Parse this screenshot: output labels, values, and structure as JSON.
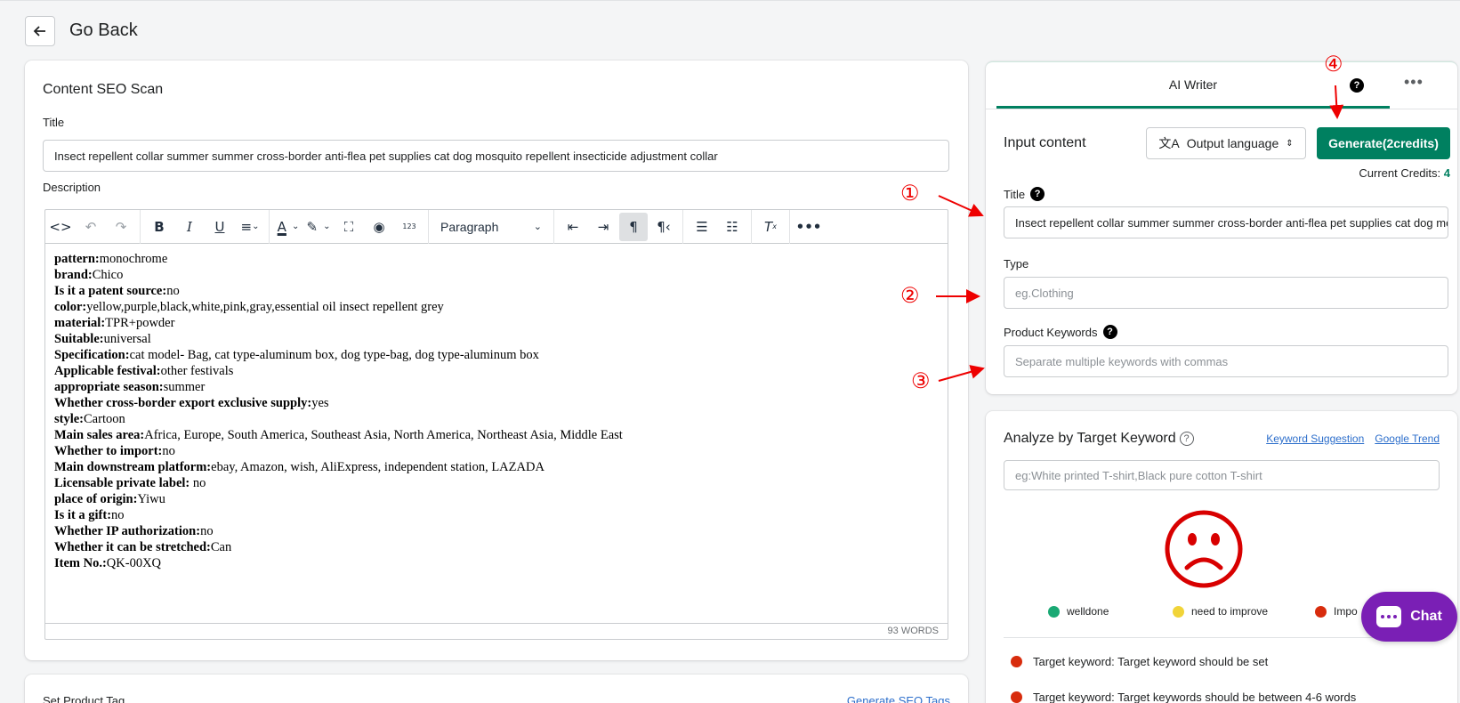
{
  "header": {
    "title": "Go Back"
  },
  "content_seo": {
    "card_title": "Content SEO Scan",
    "title_label": "Title",
    "title_value": "Insect repellent collar summer summer cross-border anti-flea pet supplies cat dog mosquito repellent insecticide adjustment collar",
    "description_label": "Description",
    "paragraph_select": "Paragraph",
    "word_count": "93 WORDS",
    "description_lines": [
      {
        "key": "pattern:",
        "value": "monochrome"
      },
      {
        "key": "brand:",
        "value": "Chico"
      },
      {
        "key": "Is it a patent source:",
        "value": "no"
      },
      {
        "key": "color:",
        "value": "yellow,purple,black,white,pink,gray,essential oil insect repellent grey"
      },
      {
        "key": "material:",
        "value": "TPR+powder"
      },
      {
        "key": "Suitable:",
        "value": "universal"
      },
      {
        "key": "Specification:",
        "value": "cat model- Bag, cat type-aluminum box, dog type-bag, dog type-aluminum box"
      },
      {
        "key": "Applicable festival:",
        "value": "other festivals"
      },
      {
        "key": "appropriate season:",
        "value": "summer"
      },
      {
        "key": "Whether cross-border export exclusive supply:",
        "value": "yes"
      },
      {
        "key": "style:",
        "value": "Cartoon"
      },
      {
        "key": "Main sales area:",
        "value": "Africa, Europe, South America, Southeast Asia, North America, Northeast Asia, Middle East"
      },
      {
        "key": "Whether to import:",
        "value": "no"
      },
      {
        "key": "Main downstream platform:",
        "value": "ebay, Amazon, wish, AliExpress, independent station, LAZADA"
      },
      {
        "key": "Licensable private label:",
        "value": " no"
      },
      {
        "key": "place of origin:",
        "value": "Yiwu"
      },
      {
        "key": "Is it a gift:",
        "value": "no"
      },
      {
        "key": "Whether IP authorization:",
        "value": "no"
      },
      {
        "key": "Whether it can be stretched:",
        "value": "Can"
      },
      {
        "key": "Item No.:",
        "value": "QK-00XQ"
      }
    ],
    "toolbar_icons": [
      "code-icon",
      "undo-icon",
      "redo-icon",
      "bold-icon",
      "italic-icon",
      "underline-icon",
      "align-icon",
      "text-color-icon",
      "highlight-icon",
      "fullscreen-icon",
      "preview-icon",
      "word-count-icon",
      "outdent-icon",
      "indent-icon",
      "ltr-icon",
      "rtl-icon",
      "bullet-list-icon",
      "numbered-list-icon",
      "clear-format-icon",
      "more-icon"
    ]
  },
  "product_tag": {
    "label": "Set Product Tag",
    "link": "Generate SEO Tags"
  },
  "ai_writer": {
    "tab": "AI Writer",
    "input_heading": "Input content",
    "language_button": "Output language",
    "generate_button": "Generate(2credits)",
    "credits_label": "Current Credits: ",
    "credits_value": "4",
    "title_label": "Title",
    "title_value": "Insect repellent collar summer summer cross-border anti-flea pet supplies cat dog mosquito repellent insecticide adjustment collar",
    "type_label": "Type",
    "type_placeholder": "eg.Clothing",
    "keywords_label": "Product Keywords",
    "keywords_placeholder": "Separate multiple keywords with commas"
  },
  "analyze": {
    "title": "Analyze by Target Keyword",
    "link_suggestion": "Keyword Suggestion",
    "link_trend": "Google Trend",
    "placeholder": "eg:White printed T-shirt,Black pure cotton T-shirt",
    "legend": [
      {
        "label": "welldone",
        "color": "#1aa974"
      },
      {
        "label": "need to improve",
        "color": "#f1d439"
      },
      {
        "label": "Impo",
        "color": "#d82c0d"
      }
    ],
    "checks": [
      "Target keyword: Target keyword should be set",
      "Target keyword: Target keywords should be between 4-6 words"
    ]
  },
  "chat": {
    "label": "Chat"
  },
  "annotations": [
    "①",
    "②",
    "③",
    "④"
  ],
  "colors": {
    "primary": "#008060",
    "link": "#2c6ecb",
    "alert": "#e00000",
    "chat": "#7a1fb5",
    "sad_face": "#d80000"
  }
}
